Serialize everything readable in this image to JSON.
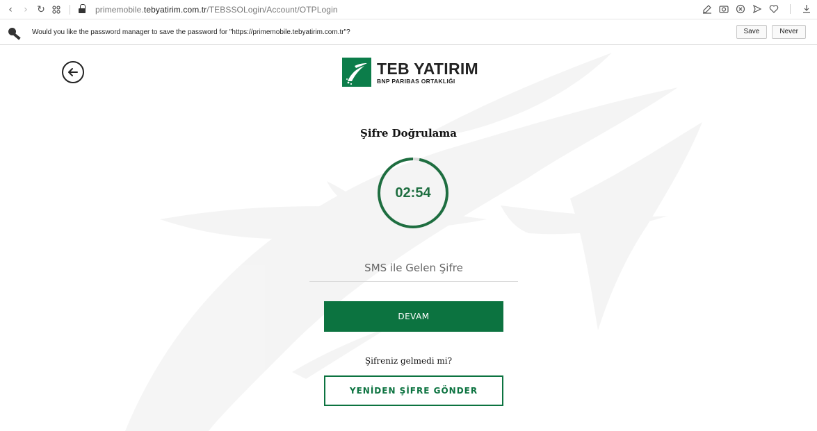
{
  "browser": {
    "url_prefix": "primemobile.",
    "url_host": "tebyatirim.com.tr",
    "url_path": "/TEBSSOLogin/Account/OTPLogin",
    "icons": [
      "back-icon",
      "forward-icon",
      "reload-icon",
      "apps-icon",
      "lock-icon",
      "edit-icon",
      "camera-icon",
      "close-circle-icon",
      "send-icon",
      "heart-icon",
      "download-icon"
    ]
  },
  "password_bar": {
    "message": "Would you like the password manager to save the password for \"https://primemobile.tebyatirim.com.tr\"?",
    "save_label": "Save",
    "never_label": "Never"
  },
  "brand": {
    "name": "TEB YATIRIM",
    "subtitle": "BNP PARIBAS ORTAKLIĞI",
    "color": "#0c7d4a"
  },
  "otp": {
    "title": "Şifre Doğrulama",
    "timer": "02:54",
    "timer_remaining_fraction": 0.97,
    "input_placeholder": "SMS ile Gelen Şifre",
    "input_value": "",
    "submit_label": "DEVAM",
    "resend_question": "Şifreniz gelmedi mi?",
    "resend_label": "YENİDEN ŞİFRE GÖNDER",
    "accent_color": "#0c7340"
  }
}
